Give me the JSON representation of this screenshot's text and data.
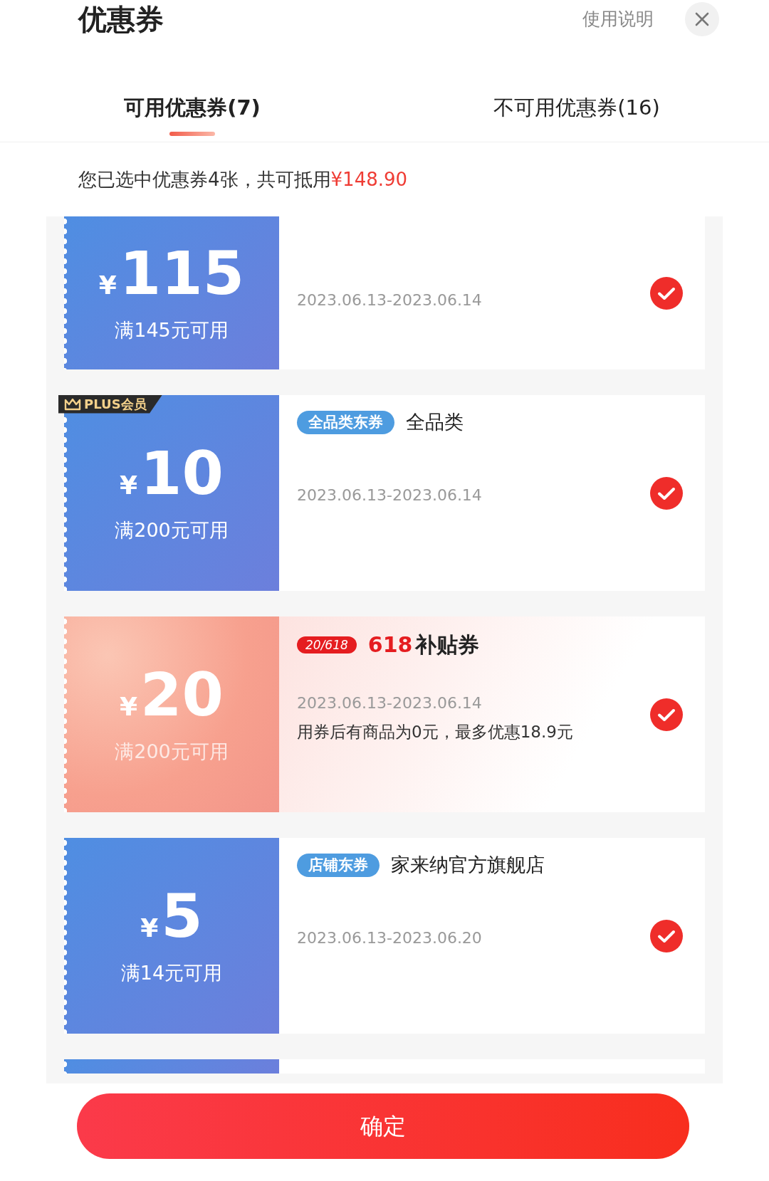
{
  "title": "优惠券",
  "help_link": "使用说明",
  "tabs": [
    {
      "label": "可用优惠券(7)",
      "selected": true
    },
    {
      "label": "不可用优惠券(16)",
      "selected": false
    }
  ],
  "summary": {
    "text": "您已选中优惠券4张，共可抵用",
    "amount": "¥148.90"
  },
  "coupons": [
    {
      "kind": "blue",
      "currency": "¥",
      "amount": "115",
      "condition": "满145元可用",
      "date": "2023.06.13-2023.06.14",
      "checked": true
    },
    {
      "kind": "blue",
      "ribbon": "PLUS会员",
      "tag": "全品类东券",
      "scope": "全品类",
      "currency": "¥",
      "amount": "10",
      "condition": "满200元可用",
      "date": "2023.06.13-2023.06.14",
      "checked": true
    },
    {
      "kind": "subsidy",
      "badge": "20/618",
      "title_prefix": "618",
      "title": "补贴券",
      "currency": "¥",
      "amount": "20",
      "condition": "满200元可用",
      "date": "2023.06.13-2023.06.14",
      "note": "用券后有商品为0元，最多优惠18.9元",
      "checked": true
    },
    {
      "kind": "blue",
      "tag": "店铺东券",
      "scope": "家来纳官方旗舰店",
      "currency": "¥",
      "amount": "5",
      "condition": "满14元可用",
      "date": "2023.06.13-2023.06.20",
      "checked": true
    },
    {
      "kind": "stub"
    }
  ],
  "confirm_button": "确定"
}
